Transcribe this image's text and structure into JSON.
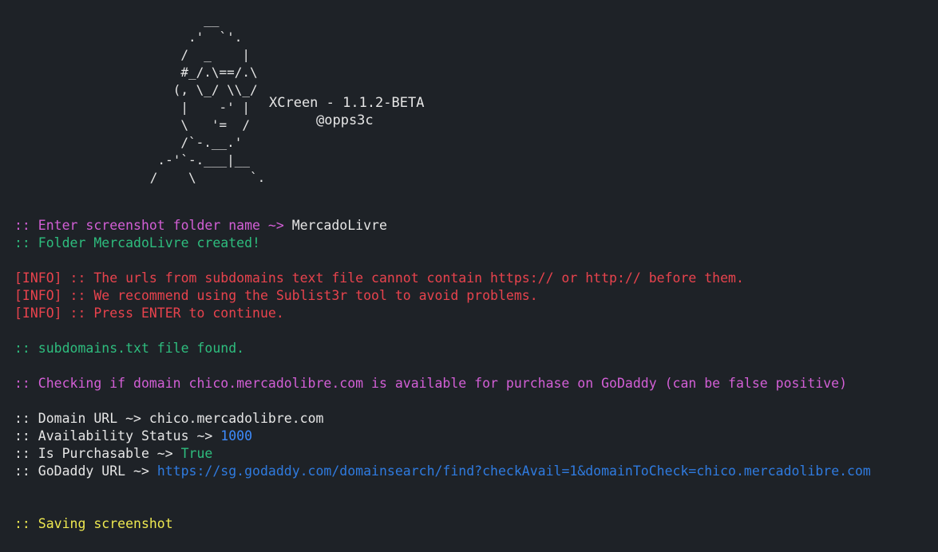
{
  "banner": {
    "art": "             __\n           .'  `'.\n          /  _    |\n          #_/.\\==/.\\\n         (, \\_/ \\\\_/\n          |    -' |\n          \\   '=  /\n          /`-.__.'\n       .-'`-.___|__\n      /    \\       `.",
    "title": "XCreen - 1.1.2-BETA",
    "author": "@opps3c"
  },
  "output": {
    "prompt_prefix": ":: Enter screenshot folder name ~> ",
    "prompt_value": "MercadoLivre",
    "folder_prefix": ":: Folder ",
    "folder_name": "MercadoLivre",
    "folder_suffix": " created!",
    "info_1": "[INFO] :: The urls from subdomains text file cannot contain https:// or http:// before them.",
    "info_2": "[INFO] :: We recommend using the Sublist3r tool to avoid problems.",
    "info_3": "[INFO] :: Press ENTER to continue.",
    "file_found": ":: subdomains.txt file found.",
    "checking": ":: Checking if domain chico.mercadolibre.com is available for purchase on GoDaddy (can be false positive)",
    "domain_url_label": ":: Domain URL ~> ",
    "domain_url_value": "chico.mercadolibre.com",
    "availability_label": ":: Availability Status ~> ",
    "availability_value": "1000",
    "purchasable_label": ":: Is Purchasable ~> ",
    "purchasable_value": "True",
    "godaddy_label": ":: GoDaddy URL ~> ",
    "godaddy_value": "https://sg.godaddy.com/domainsearch/find?checkAvail=1&domainToCheck=chico.mercadolibre.com",
    "saving": ":: Saving screenshot"
  },
  "colors": {
    "background": "#1e2227",
    "magenta": "#d35fd6",
    "green": "#2ebd7e",
    "red": "#e8434d",
    "blue": "#3d8bfd",
    "yellow": "#eee850"
  }
}
